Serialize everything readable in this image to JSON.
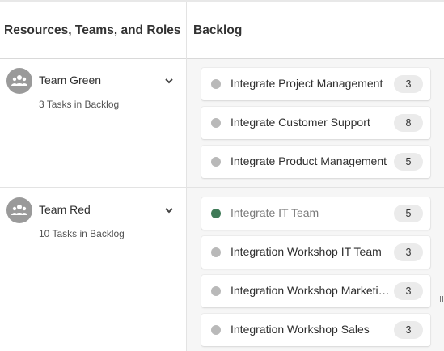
{
  "header": {
    "left_title": "Resources, Teams, and Roles",
    "right_title": "Backlog"
  },
  "teams": [
    {
      "name": "Team Green",
      "subtitle": "3 Tasks in Backlog",
      "tasks": [
        {
          "title": "Integrate Project Management",
          "count": "3",
          "status": "inactive"
        },
        {
          "title": "Integrate Customer Support",
          "count": "8",
          "status": "inactive"
        },
        {
          "title": "Integrate Product Management",
          "count": "5",
          "status": "inactive"
        }
      ]
    },
    {
      "name": "Team Red",
      "subtitle": "10 Tasks in Backlog",
      "tasks": [
        {
          "title": "Integrate IT Team",
          "count": "5",
          "status": "active"
        },
        {
          "title": "Integration Workshop IT Team",
          "count": "3",
          "status": "inactive"
        },
        {
          "title": "Integration Workshop Marketing",
          "count": "3",
          "status": "inactive"
        },
        {
          "title": "Integration Workshop Sales",
          "count": "3",
          "status": "inactive"
        }
      ]
    }
  ],
  "colors": {
    "active_dot": "#3f7a57",
    "inactive_dot": "#b9b9b9",
    "avatar": "#9a9a9a"
  },
  "icons": {
    "avatar": "team-icon",
    "expand": "chevron-down-icon",
    "status": "status-dot-icon"
  }
}
